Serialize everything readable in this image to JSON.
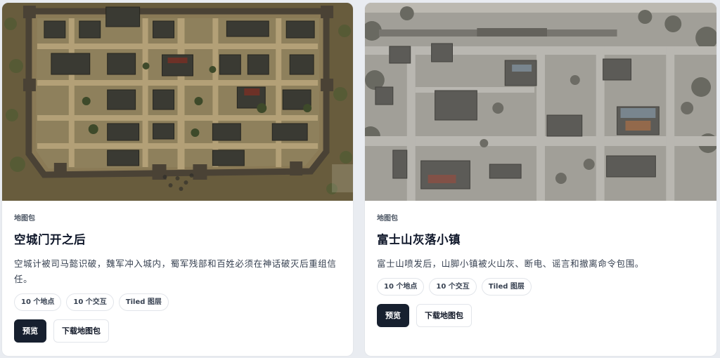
{
  "cards": [
    {
      "tag": "地图包",
      "title": "空城门开之后",
      "description": "空城计被司马懿识破，魏军冲入城内，蜀军残部和百姓必须在神话破灭后重组信任。",
      "chips": [
        "10 个地点",
        "10 个交互",
        "Tiled 图层"
      ],
      "preview_label": "预览",
      "download_label": "下载地图包",
      "thumbnail": "ancient-walled-city-map"
    },
    {
      "tag": "地图包",
      "title": "富士山灰落小镇",
      "description": "富士山喷发后，山脚小镇被火山灰、断电、谣言和撤离命令包围。",
      "chips": [
        "10 个地点",
        "10 个交互",
        "Tiled 图层"
      ],
      "preview_label": "预览",
      "download_label": "下载地图包",
      "thumbnail": "ash-covered-town-map"
    }
  ],
  "colors": {
    "primary_button": "#17202f",
    "page_bg": "#e9ecf1",
    "card_bg": "#ffffff"
  }
}
